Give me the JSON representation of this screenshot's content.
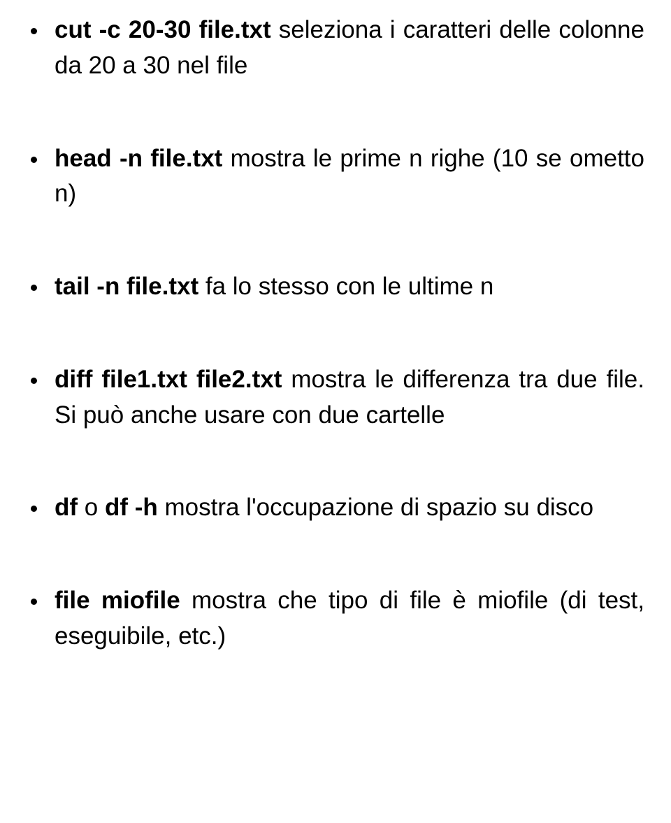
{
  "items": [
    {
      "cmd": "cut -c 20-30 file.txt",
      "desc": " seleziona i caratteri delle colonne da 20 a 30 nel file"
    },
    {
      "cmd": "head -n file.txt",
      "desc": " mostra le prime n righe (10 se ometto n)"
    },
    {
      "cmd": "tail -n file.txt",
      "desc": " fa lo stesso con le ultime n"
    },
    {
      "cmd": "diff file1.txt file2.txt",
      "desc": " mostra le differenza tra due file. Si può anche usare con due cartelle"
    },
    {
      "cmd": "df",
      "mid": " o ",
      "cmd2": "df -h",
      "desc": " mostra l'occupazione di spazio su disco"
    },
    {
      "cmd": "file miofile",
      "desc": " mostra che tipo di file è miofile (di test, eseguibile, etc.)"
    }
  ]
}
